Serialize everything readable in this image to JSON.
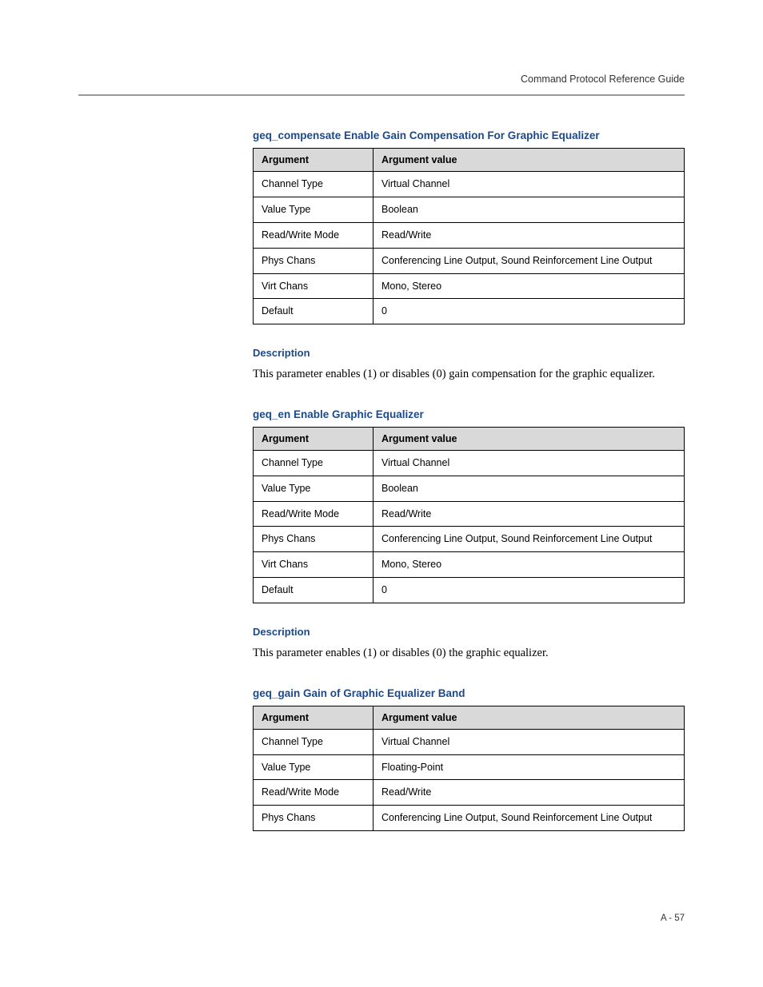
{
  "header": {
    "title": "Command Protocol Reference Guide"
  },
  "sections": [
    {
      "title": "geq_compensate Enable Gain Compensation For Graphic Equalizer",
      "table": {
        "headers": [
          "Argument",
          "Argument value"
        ],
        "rows": [
          [
            "Channel Type",
            "Virtual Channel"
          ],
          [
            "Value Type",
            "Boolean"
          ],
          [
            "Read/Write Mode",
            "Read/Write"
          ],
          [
            "Phys Chans",
            "Conferencing Line Output, Sound Reinforcement Line Output"
          ],
          [
            "Virt Chans",
            "Mono, Stereo"
          ],
          [
            "Default",
            "0"
          ]
        ]
      },
      "desc_heading": "Description",
      "desc_text": "This parameter enables (1) or disables (0) gain compensation for the graphic equalizer."
    },
    {
      "title": "geq_en Enable Graphic Equalizer",
      "table": {
        "headers": [
          "Argument",
          "Argument value"
        ],
        "rows": [
          [
            "Channel Type",
            "Virtual Channel"
          ],
          [
            "Value Type",
            "Boolean"
          ],
          [
            "Read/Write Mode",
            "Read/Write"
          ],
          [
            "Phys Chans",
            "Conferencing Line Output, Sound Reinforcement Line Output"
          ],
          [
            "Virt Chans",
            "Mono, Stereo"
          ],
          [
            "Default",
            "0"
          ]
        ]
      },
      "desc_heading": "Description",
      "desc_text": "This parameter enables (1) or disables (0) the graphic equalizer."
    },
    {
      "title": "geq_gain Gain of Graphic Equalizer Band",
      "table": {
        "headers": [
          "Argument",
          "Argument value"
        ],
        "rows": [
          [
            "Channel Type",
            "Virtual Channel"
          ],
          [
            "Value Type",
            "Floating-Point"
          ],
          [
            "Read/Write Mode",
            "Read/Write"
          ],
          [
            "Phys Chans",
            "Conferencing Line Output, Sound Reinforcement Line Output"
          ]
        ]
      }
    }
  ],
  "footer": {
    "page_number": "A - 57"
  }
}
